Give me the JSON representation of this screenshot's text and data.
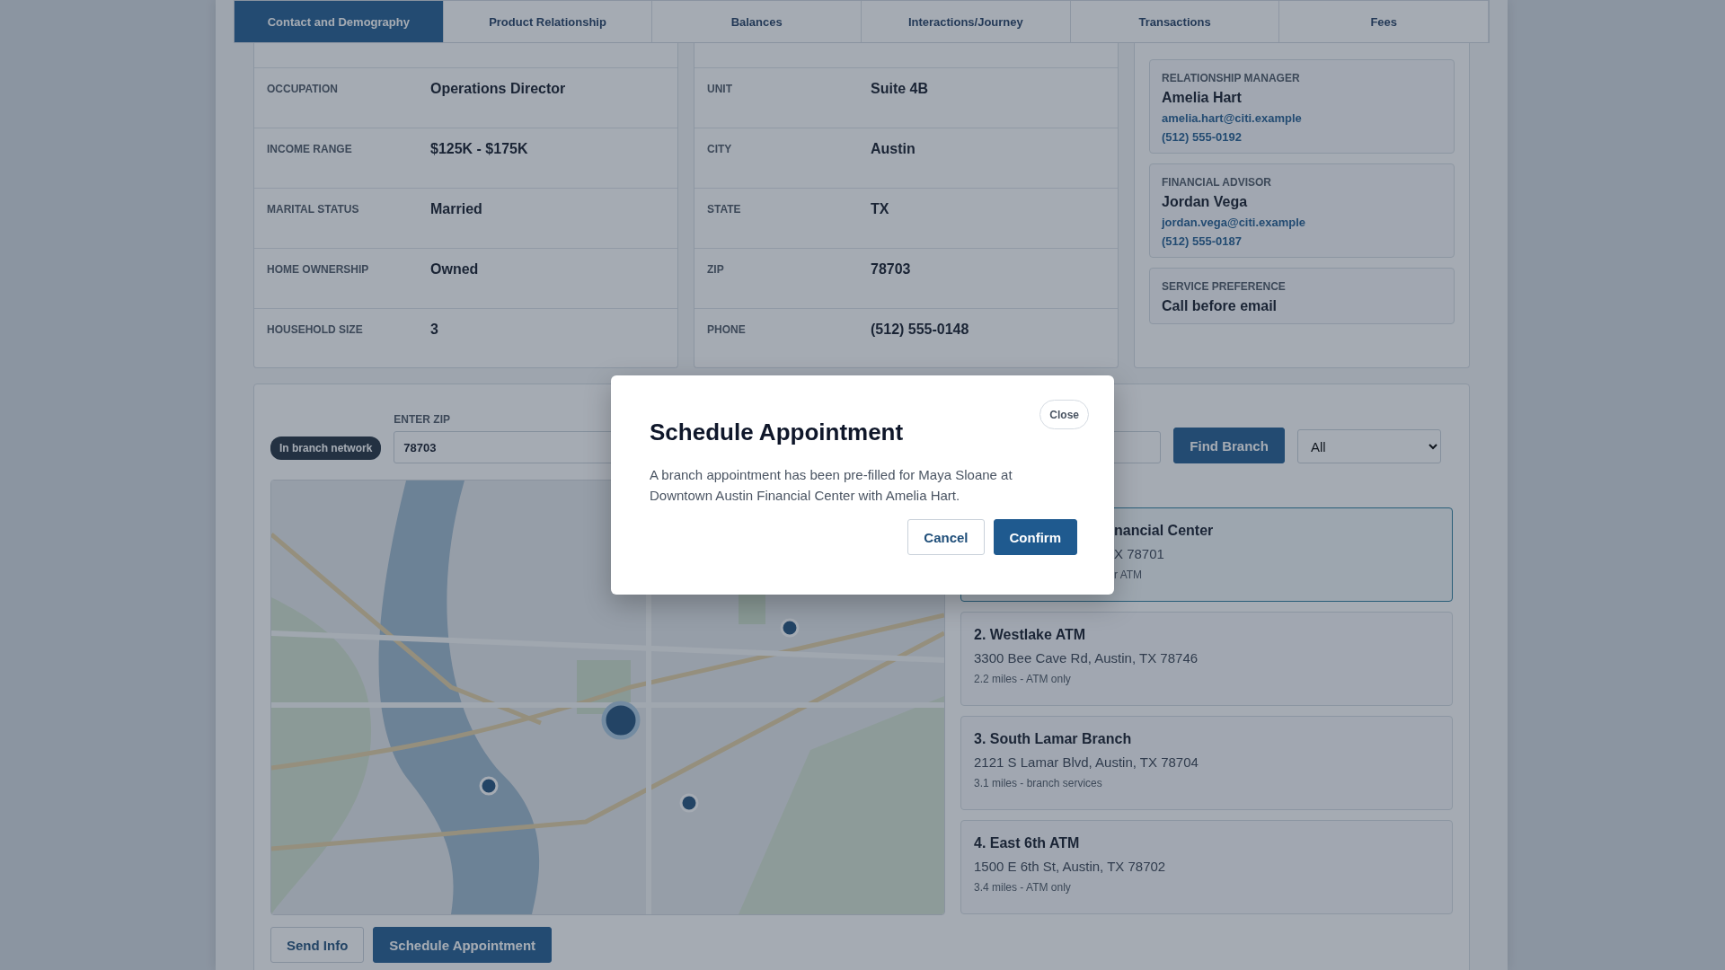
{
  "tabs": [
    {
      "label": "Contact and Demography",
      "selected": true
    },
    {
      "label": "Product Relationship",
      "selected": false
    },
    {
      "label": "Balances",
      "selected": false
    },
    {
      "label": "Interactions/Journey",
      "selected": false
    },
    {
      "label": "Transactions",
      "selected": false
    },
    {
      "label": "Fees",
      "selected": false
    }
  ],
  "demographics": [
    {
      "label": "OCCUPATION",
      "value": "Operations Director"
    },
    {
      "label": "INCOME RANGE",
      "value": "$125K - $175K"
    },
    {
      "label": "MARITAL STATUS",
      "value": "Married"
    },
    {
      "label": "HOME OWNERSHIP",
      "value": "Owned"
    },
    {
      "label": "HOUSEHOLD SIZE",
      "value": "3"
    }
  ],
  "address": [
    {
      "label": "UNIT",
      "value": "Suite 4B"
    },
    {
      "label": "CITY",
      "value": "Austin"
    },
    {
      "label": "STATE",
      "value": "TX"
    },
    {
      "label": "ZIP",
      "value": "78703"
    },
    {
      "label": "PHONE",
      "value": "(512) 555-0148"
    }
  ],
  "contacts": [
    {
      "role": "RELATIONSHIP MANAGER",
      "name": "Amelia Hart",
      "email": "amelia.hart@citi.example",
      "phone": "(512) 555-0192"
    },
    {
      "role": "FINANCIAL ADVISOR",
      "name": "Jordan Vega",
      "email": "jordan.vega@citi.example",
      "phone": "(512) 555-0187"
    },
    {
      "role": "SERVICE PREFERENCE",
      "name": "Call before email"
    }
  ],
  "branch_finder": {
    "badge": "In branch network",
    "zip": {
      "label": "ENTER ZIP",
      "value": "78703"
    },
    "find_button": "Find Branch",
    "filter": {
      "value": "All"
    },
    "branches": [
      {
        "name": "nancial Center",
        "address": "X 78701",
        "detail": "r ATM",
        "selected": true,
        "covered": true
      },
      {
        "name": "2. Westlake ATM",
        "address": "3300 Bee Cave Rd, Austin, TX 78746",
        "detail": "2.2 miles - ATM only",
        "selected": false,
        "covered": false
      },
      {
        "name": "3. South Lamar Branch",
        "address": "2121 S Lamar Blvd, Austin, TX 78704",
        "detail": "3.1 miles - branch services",
        "selected": false,
        "covered": false
      },
      {
        "name": "4. East 6th ATM",
        "address": "1500 E 6th St, Austin, TX 78702",
        "detail": "3.4 miles - ATM only",
        "selected": false,
        "covered": false
      }
    ],
    "actions": [
      "Send Info",
      "Schedule Appointment"
    ]
  },
  "modal": {
    "title": "Schedule Appointment",
    "message": "A branch appointment has been pre-filled for Maya Sloane at Downtown Austin Financial Center with Amelia Hart.",
    "close": "Close",
    "buttons": [
      "Cancel",
      "Confirm"
    ]
  }
}
